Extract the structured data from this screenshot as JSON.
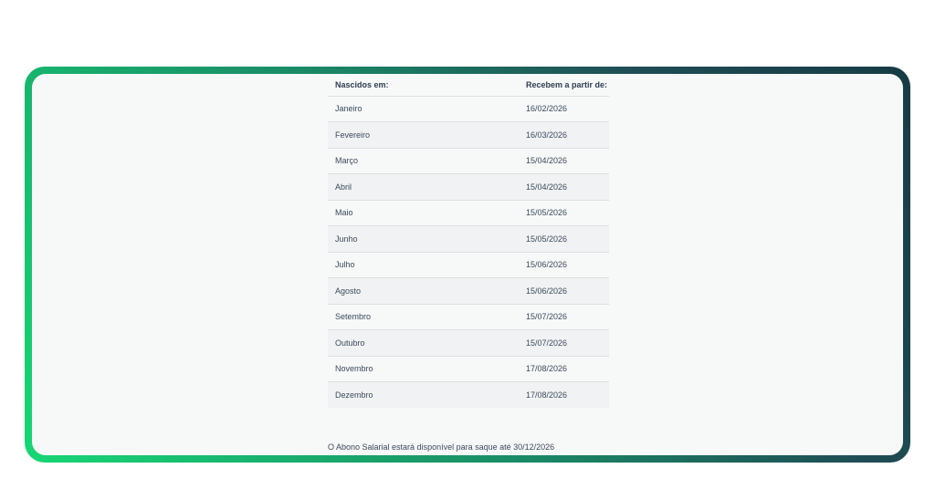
{
  "table": {
    "headers": [
      "Nascidos em:",
      "Recebem a partir de:"
    ],
    "rows": [
      {
        "month": "Janeiro",
        "date": "16/02/2026"
      },
      {
        "month": "Fevereiro",
        "date": "16/03/2026"
      },
      {
        "month": "Março",
        "date": "15/04/2026"
      },
      {
        "month": "Abril",
        "date": "15/04/2026"
      },
      {
        "month": "Maio",
        "date": "15/05/2026"
      },
      {
        "month": "Junho",
        "date": "15/05/2026"
      },
      {
        "month": "Julho",
        "date": "15/06/2026"
      },
      {
        "month": "Agosto",
        "date": "15/06/2026"
      },
      {
        "month": "Setembro",
        "date": "15/07/2026"
      },
      {
        "month": "Outubro",
        "date": "15/07/2026"
      },
      {
        "month": "Novembro",
        "date": "17/08/2026"
      },
      {
        "month": "Dezembro",
        "date": "17/08/2026"
      }
    ]
  },
  "footnote": "O Abono Salarial estará disponível para saque até 30/12/2026",
  "colors": {
    "frame_gradient_start": "#17d775",
    "frame_gradient_end": "#173b44",
    "panel_background": "#f7f8f8",
    "text": "#3a4a5e"
  }
}
